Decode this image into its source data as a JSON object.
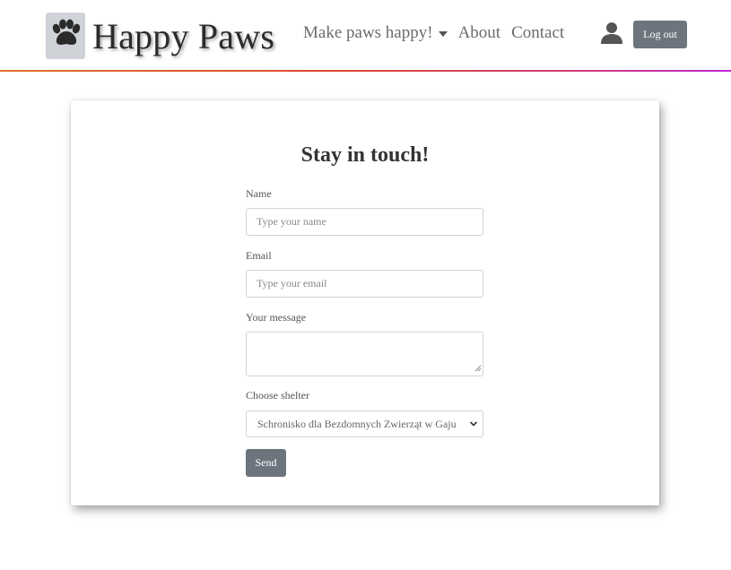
{
  "nav": {
    "brand": "Happy Paws",
    "logo_icon": "paw-icon",
    "links": {
      "make_paws_happy": "Make paws happy!",
      "about": "About",
      "contact": "Contact"
    },
    "user_icon": "user-icon",
    "logout_label": "Log out",
    "accent_gradient": [
      "#e0712a",
      "#dd4a2e",
      "#c228d8"
    ]
  },
  "form": {
    "title": "Stay in touch!",
    "name_label": "Name",
    "name_placeholder": "Type your name",
    "name_value": "",
    "email_label": "Email",
    "email_placeholder": "Type your email",
    "email_value": "",
    "message_label": "Your message",
    "message_value": "",
    "shelter_label": "Choose shelter",
    "shelter_selected": "Schronisko dla Bezdomnych Zwierząt w Gaju",
    "send_label": "Send",
    "button_color": "#6c757d"
  }
}
